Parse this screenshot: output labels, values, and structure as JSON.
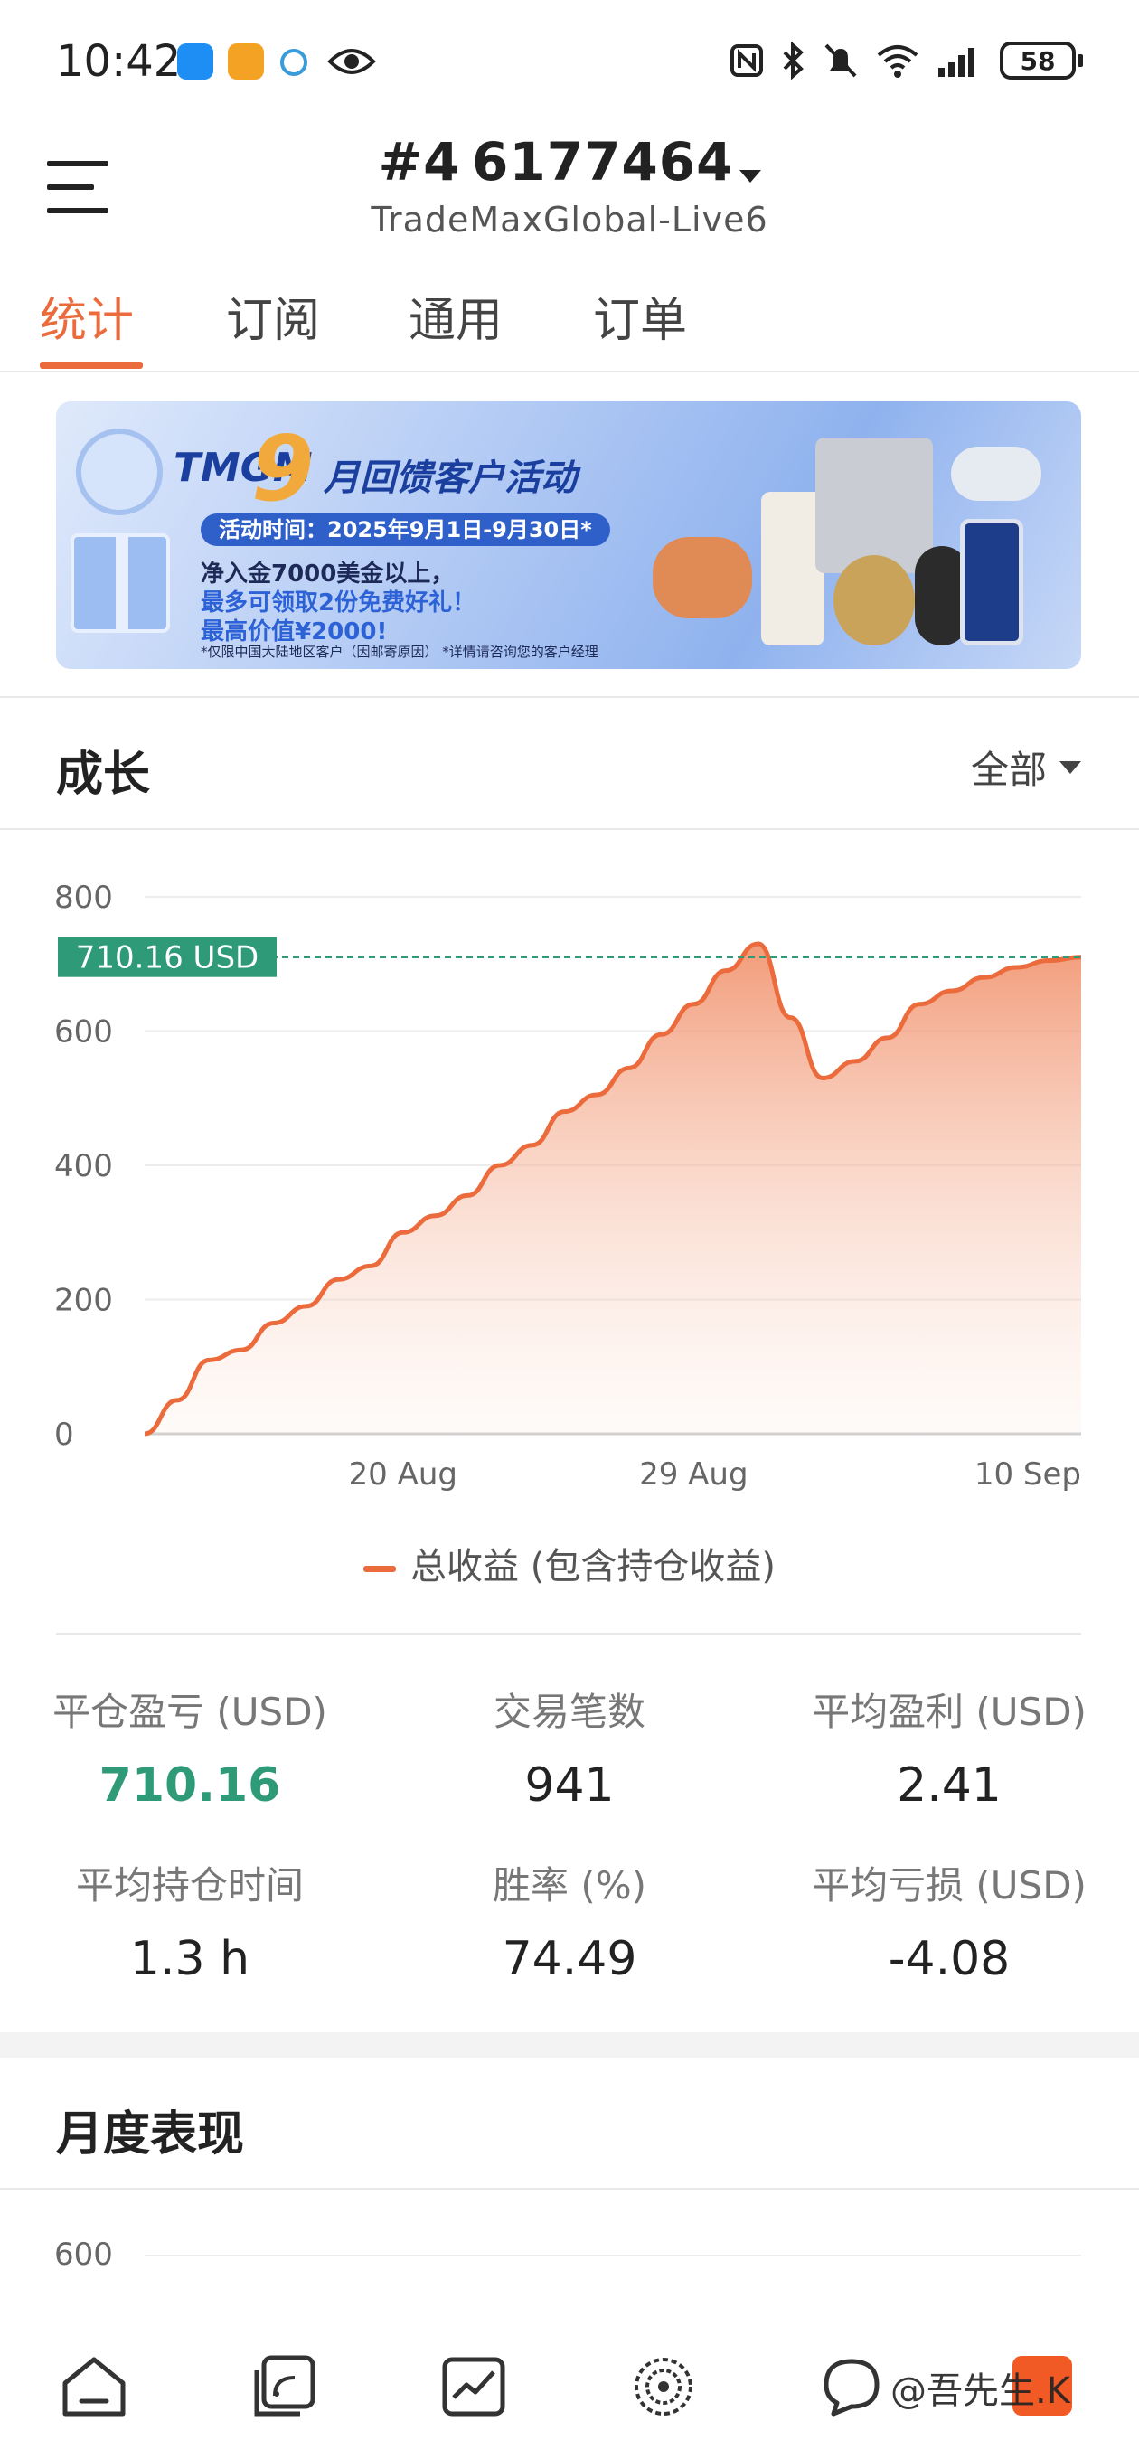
{
  "status_bar": {
    "time": "10:42",
    "battery": "58"
  },
  "header": {
    "account_number": "#4 6177464",
    "server": "TradeMaxGlobal-Live6"
  },
  "tabs": [
    {
      "label": "统计",
      "active": true
    },
    {
      "label": "订阅",
      "active": false
    },
    {
      "label": "通用",
      "active": false
    },
    {
      "label": "订单",
      "active": false
    }
  ],
  "banner": {
    "brand": "TMGM",
    "big_number": "9",
    "title": "月回馈客户活动",
    "date": "活动时间：2025年9月1日-9月30日*",
    "line1": "净入金7000美金以上，",
    "line2": "最多可领取2份免费好礼！",
    "line3": "最高价值¥2000!",
    "note": "*仅限中国大陆地区客户（因邮寄原因）  *详情请咨询您的客户经理"
  },
  "growth": {
    "title": "成长",
    "filter": "全部",
    "current_value_label": "710.16 USD",
    "legend": "总收益 (包含持仓收益)"
  },
  "chart_data": {
    "type": "area",
    "title": "",
    "xlabel": "",
    "ylabel": "",
    "ylim": [
      0,
      800
    ],
    "yticks": [
      "0",
      "200",
      "400",
      "600",
      "800"
    ],
    "xticks": [
      "20 Aug",
      "29 Aug",
      "10 Sep"
    ],
    "reference_line": 710.16,
    "series": [
      {
        "name": "总收益 (包含持仓收益)",
        "color": "#ec6b3c",
        "x": [
          "12 Aug",
          "13 Aug",
          "14 Aug",
          "15 Aug",
          "16 Aug",
          "17 Aug",
          "18 Aug",
          "19 Aug",
          "20 Aug",
          "21 Aug",
          "22 Aug",
          "23 Aug",
          "24 Aug",
          "25 Aug",
          "26 Aug",
          "27 Aug",
          "28 Aug",
          "29 Aug",
          "30 Aug",
          "31 Aug",
          "1 Sep",
          "2 Sep",
          "3 Sep",
          "4 Sep",
          "5 Sep",
          "6 Sep",
          "7 Sep",
          "8 Sep",
          "9 Sep",
          "10 Sep"
        ],
        "values": [
          0,
          50,
          110,
          125,
          165,
          190,
          230,
          250,
          300,
          325,
          355,
          400,
          430,
          480,
          505,
          545,
          595,
          640,
          690,
          730,
          620,
          530,
          555,
          590,
          640,
          660,
          680,
          695,
          705,
          710.16
        ]
      }
    ]
  },
  "stats": {
    "closed_pl_label": "平仓盈亏 (USD)",
    "closed_pl_value": "710.16",
    "trades_label": "交易笔数",
    "trades_value": "941",
    "avg_profit_label": "平均盈利 (USD)",
    "avg_profit_value": "2.41",
    "avg_hold_label": "平均持仓时间",
    "avg_hold_value": "1.3 h",
    "win_rate_label": "胜率 (%)",
    "win_rate_value": "74.49",
    "avg_loss_label": "平均亏损 (USD)",
    "avg_loss_value": "-4.08"
  },
  "monthly": {
    "title": "月度表现",
    "first_tick": "600"
  },
  "watermark": "@吾先生.K",
  "colors": {
    "accent": "#ec6b3c",
    "positive": "#2f9a78"
  }
}
